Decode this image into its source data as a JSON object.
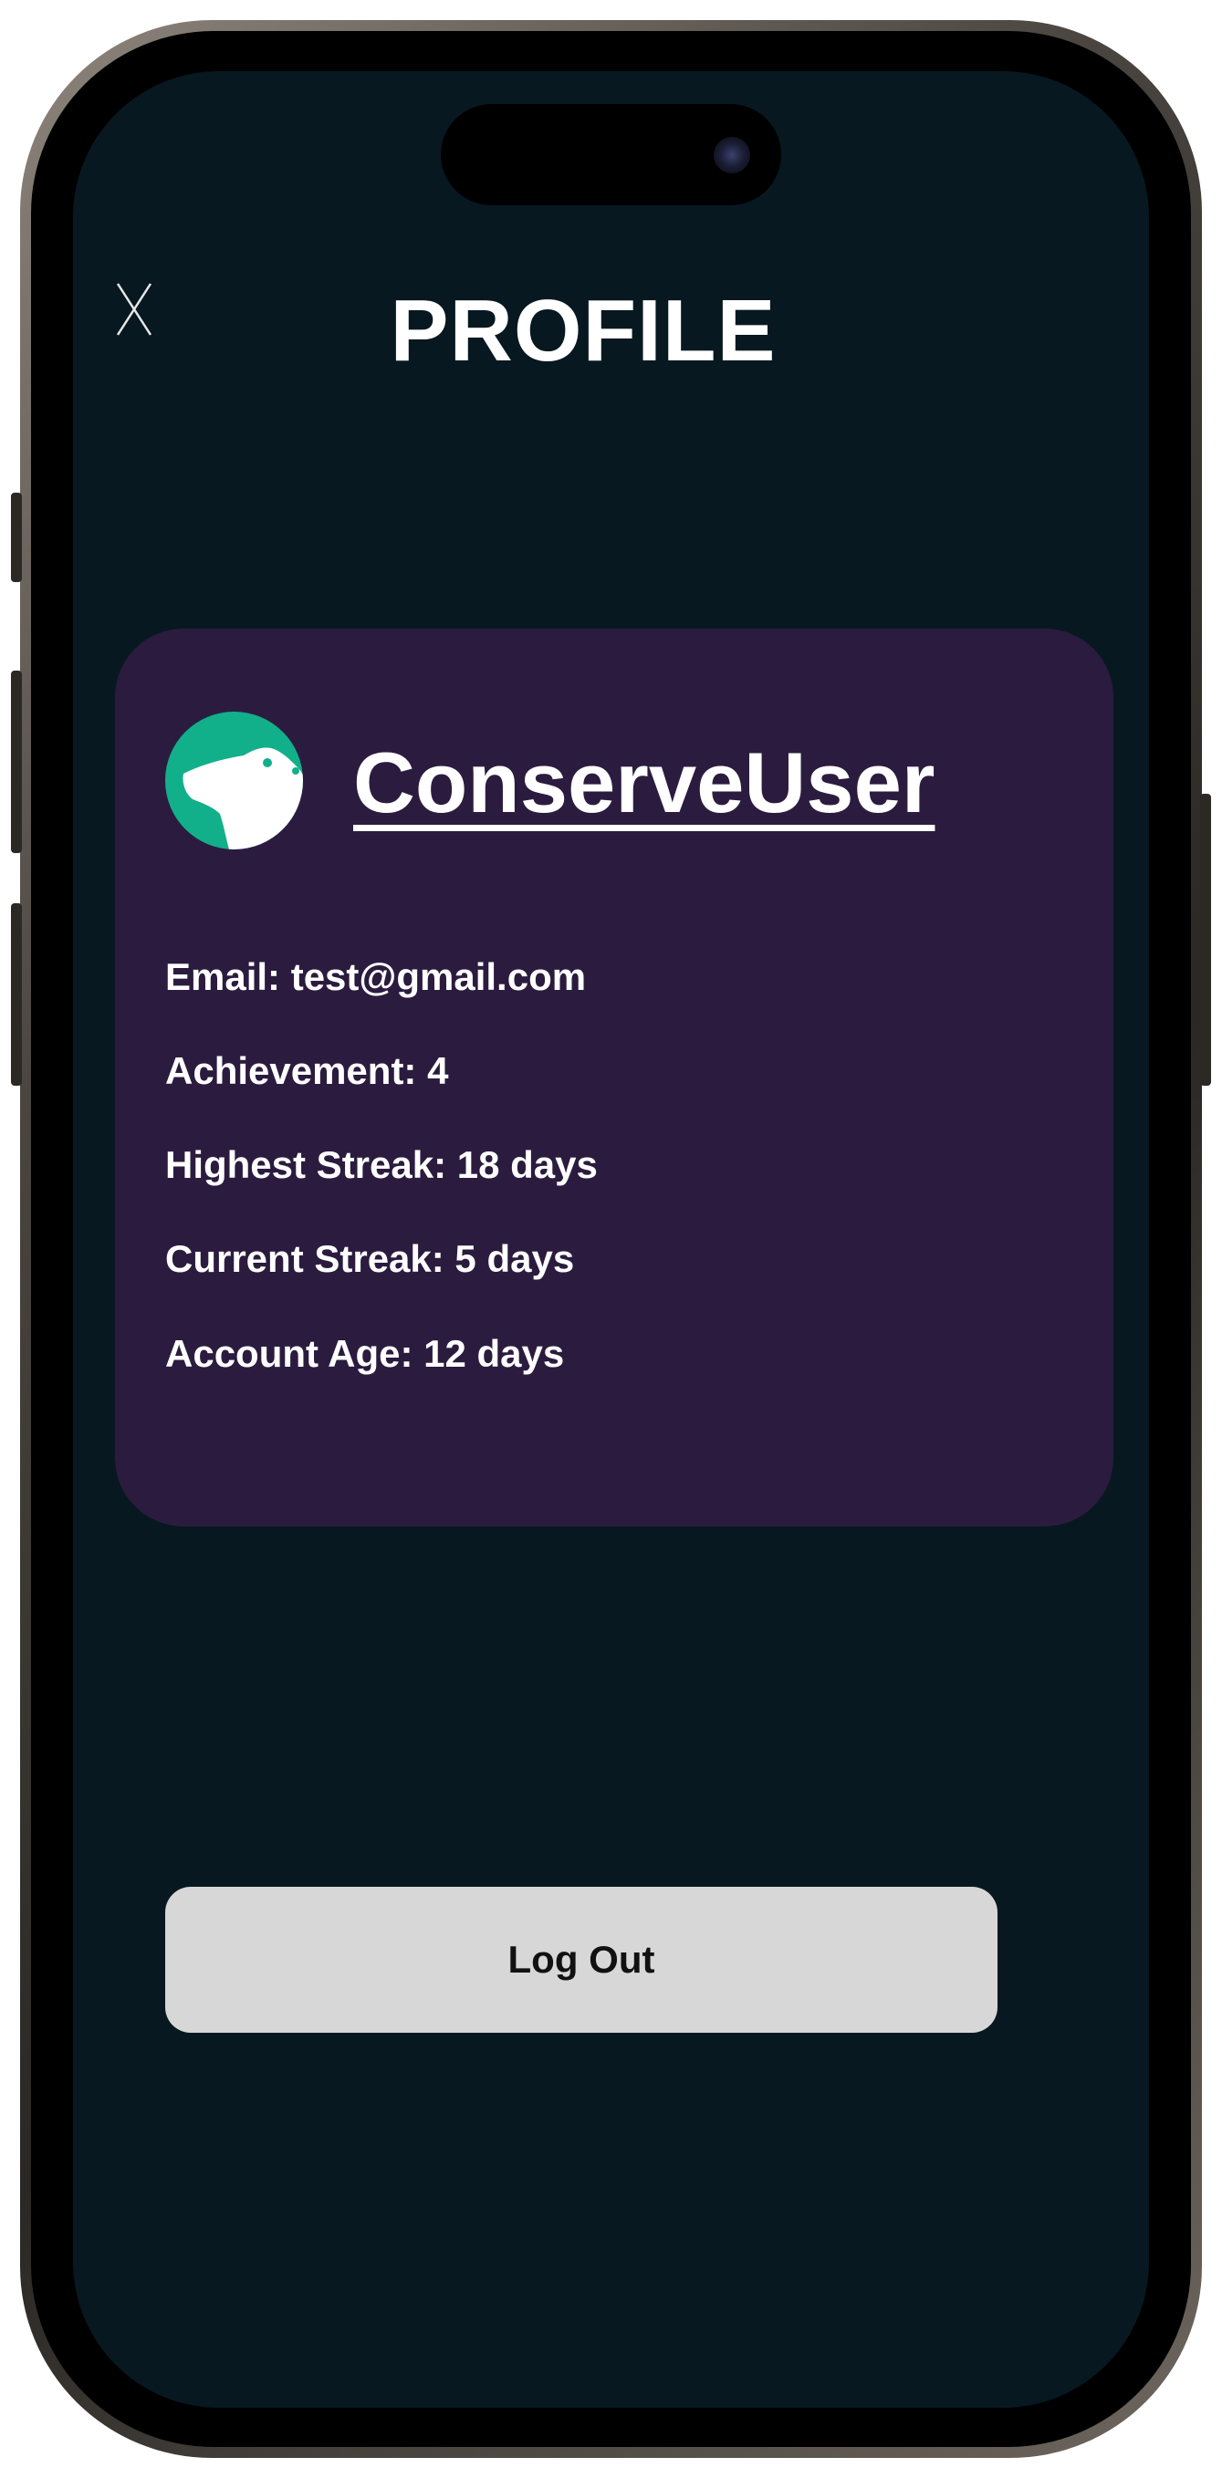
{
  "screen": {
    "title": "PROFILE",
    "close_icon": "close-x-icon",
    "background_color": "#081820"
  },
  "profile": {
    "avatar_icon": "polar-bear-icon",
    "avatar_color": "#12b08a",
    "username": "ConserveUser",
    "card_color": "#2b1c3f",
    "email": "Email: test@gmail.com",
    "achievement": "Achievement: 4",
    "highest_streak": "Highest Streak: 18 days",
    "current_streak": "Current Streak: 5 days",
    "account_age": "Account Age: 12 days"
  },
  "actions": {
    "logout_label": "Log Out"
  }
}
